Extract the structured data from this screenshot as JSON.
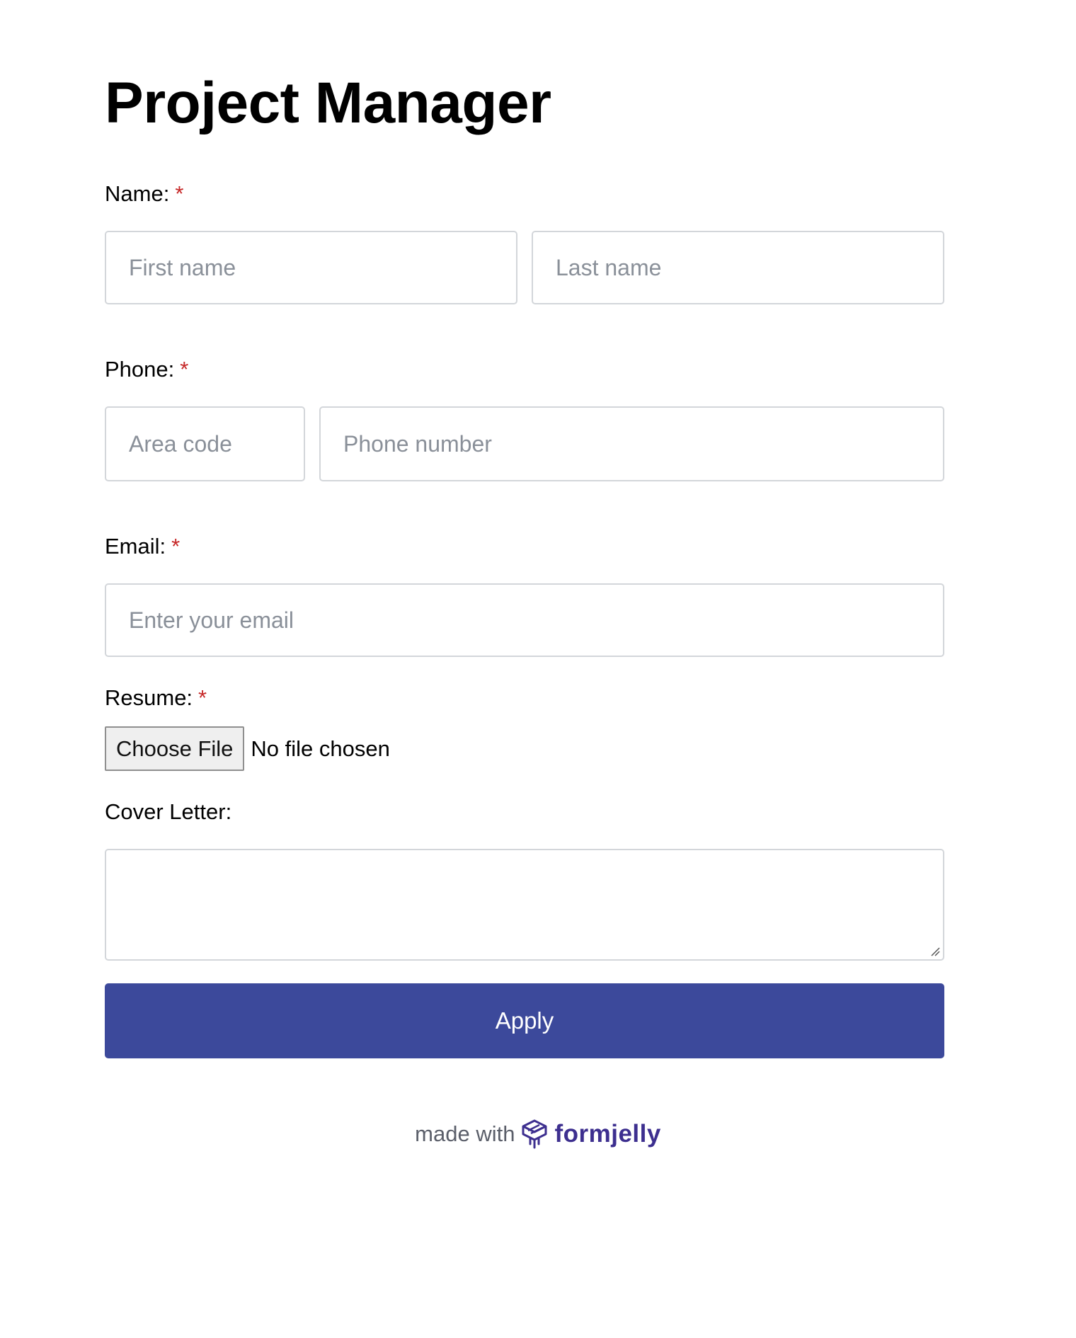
{
  "page": {
    "title": "Project Manager"
  },
  "fields": {
    "name": {
      "label": "Name:",
      "required_mark": "*",
      "first_placeholder": "First name",
      "last_placeholder": "Last name"
    },
    "phone": {
      "label": "Phone:",
      "required_mark": "*",
      "area_placeholder": "Area code",
      "number_placeholder": "Phone number"
    },
    "email": {
      "label": "Email:",
      "required_mark": "*",
      "placeholder": "Enter your email"
    },
    "resume": {
      "label": "Resume:",
      "required_mark": "*",
      "button_label": "Choose File",
      "status": "No file chosen"
    },
    "cover_letter": {
      "label": "Cover Letter:"
    }
  },
  "submit": {
    "label": "Apply"
  },
  "footer": {
    "made_with": "made with",
    "brand": "formjelly"
  },
  "colors": {
    "accent": "#3c499b",
    "required": "#c62828",
    "brand": "#3d2f8f"
  },
  "icons": {
    "brand_logo": "formjelly-logo-icon"
  }
}
